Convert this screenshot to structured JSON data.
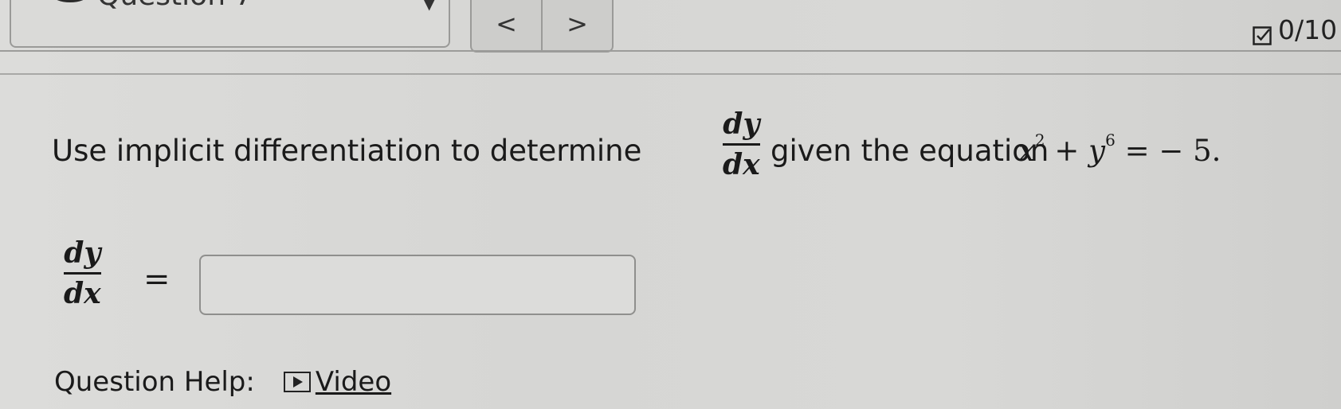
{
  "header": {
    "question_label": "Question 7",
    "prev_label": "<",
    "next_label": ">",
    "score": "0/10"
  },
  "question": {
    "prefix": "Use implicit differentiation to determine",
    "frac_num": "dy",
    "frac_den": "dx",
    "middle": "given the equation",
    "equation_x": "x",
    "exp_x": "2",
    "plus": "+",
    "equation_y": "y",
    "exp_y": "6",
    "rhs": "= − 5."
  },
  "answer": {
    "frac_num": "dy",
    "frac_den": "dx",
    "equals": "=",
    "value": ""
  },
  "help": {
    "label": "Question Help:",
    "video_label": "Video"
  }
}
